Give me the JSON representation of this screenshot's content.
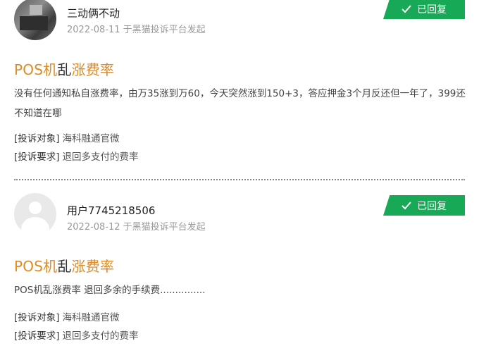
{
  "complaints": [
    {
      "username": "三动俩不动",
      "meta": "2022-08-11 于黑猫投诉平台发起",
      "status": "已回复",
      "title_part1": "POS机",
      "title_part2": "乱",
      "title_part3": "涨费率",
      "content": "没有任何通知私自涨费率，由万35涨到万60，今天突然涨到150+3，答应押金3个月反还但一年了，399还不知道在哪",
      "target_label": "[投诉对象]",
      "target_value": "海科融通官微",
      "demand_label": "[投诉要求]",
      "demand_value": "退回多支付的费率",
      "avatar": "user-photo"
    },
    {
      "username": "用户7745218506",
      "meta": "2022-08-12 于黑猫投诉平台发起",
      "status": "已回复",
      "title_part1": "POS机",
      "title_part2": "乱",
      "title_part3": "涨费率",
      "content": "POS机乱涨费率 退回多余的手续费...............",
      "target_label": "[投诉对象]",
      "target_value": "海科融通官微",
      "demand_label": "[投诉要求]",
      "demand_value": "退回多支付的费率",
      "avatar": "default-user-icon"
    }
  ],
  "colors": {
    "accent_orange": "#e08a24",
    "status_green": "#18a956",
    "meta_gray": "#999999"
  }
}
